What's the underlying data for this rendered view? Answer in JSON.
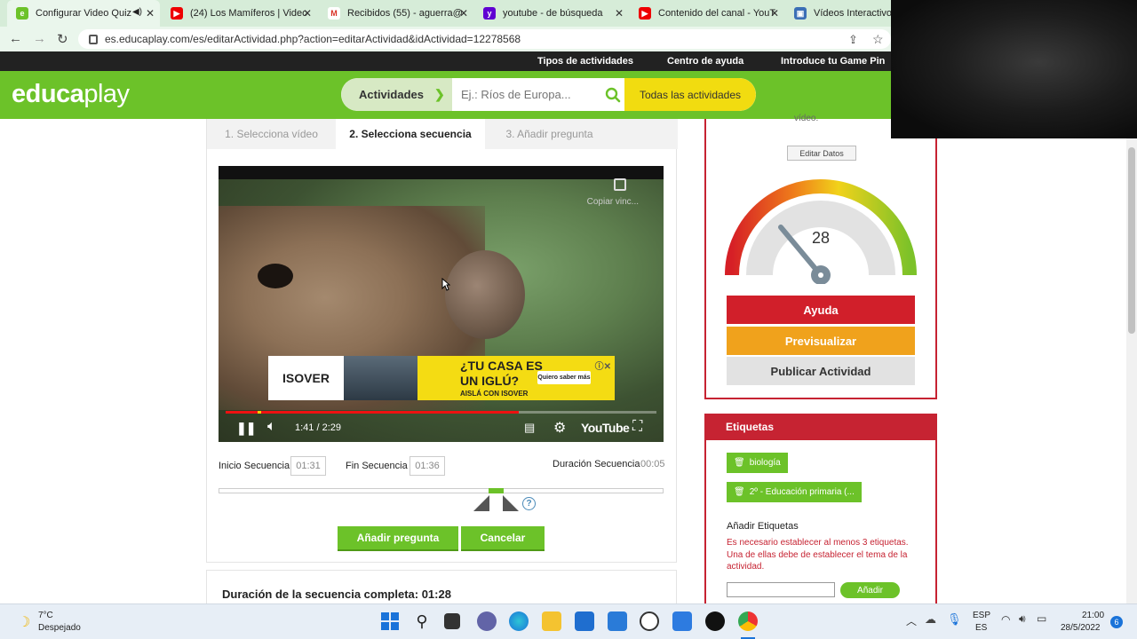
{
  "browser": {
    "tabs": [
      {
        "title": "Configurar Video Quiz",
        "active": true,
        "fav_color": "#6cc229",
        "fav": "e"
      },
      {
        "title": "(24) Los Mamíferos | Video",
        "active": false,
        "fav_color": "#e00",
        "fav": "▶"
      },
      {
        "title": "Recibidos (55) - aguerra@",
        "active": false,
        "fav_color": "#d93025",
        "fav": "M"
      },
      {
        "title": "youtube - de búsqueda",
        "active": false,
        "fav_color": "#6001d2",
        "fav": "y"
      },
      {
        "title": "Contenido del canal - YouT",
        "active": false,
        "fav_color": "#e00",
        "fav": "▶"
      },
      {
        "title": "Vídeos Interactivos: A",
        "active": false,
        "fav_color": "#3b6fb6",
        "fav": "▣"
      }
    ],
    "url": "es.educaplay.com/es/editarActividad.php?action=editarActividad&idActividad=12278568"
  },
  "topbar": {
    "links": [
      "Tipos de actividades",
      "Centro de ayuda",
      "Introduce tu Game Pin"
    ]
  },
  "header": {
    "logo_a": "educa",
    "logo_b": "play",
    "activities_label": "Actividades",
    "search_placeholder": "Ej.: Ríos de Europa...",
    "all_activities": "Todas las actividades"
  },
  "steps": [
    "1. Selecciona vídeo",
    "2. Selecciona secuencia",
    "3. Añadir pregunta"
  ],
  "video": {
    "copy_label": "Copiar vinc...",
    "time": "1:41 / 2:29",
    "played_fraction": 0.68,
    "brand": "YouTube",
    "ad": {
      "brand": "ISOVER",
      "line1": "¿TU CASA ES",
      "line2": "UN IGLÚ?",
      "line3": "AISLÁ CON ISOVER",
      "cta": "Quiero saber más"
    }
  },
  "sequence": {
    "start_label": "Inicio Secuencia",
    "start_value": "01:31",
    "end_label": "Fin Secuencia",
    "end_value": "01:36",
    "duration_label": "Duración Secuencia",
    "duration_value": "00:05",
    "help": "?",
    "add_question": "Añadir pregunta",
    "cancel": "Cancelar",
    "full_duration": "Duración de la secuencia completa:",
    "full_duration_value": "01:28"
  },
  "side": {
    "video_text": "vídeo.",
    "edit_data": "Editar Datos",
    "gauge_value": "28",
    "help": "Ayuda",
    "preview": "Previsualizar",
    "publish": "Publicar Actividad",
    "tags_title": "Etiquetas",
    "tags": [
      "biología",
      "2º - Educación primaria (..."
    ],
    "add_tags_label": "Añadir Etiquetas",
    "warning": "Es necesario establecer al menos 3 etiquetas. Una de ellas debe de establecer el tema de la actividad.",
    "add_button": "Añadir"
  },
  "taskbar": {
    "weather_temp": "7°C",
    "weather_desc": "Despejado",
    "lang1": "ESP",
    "lang2": "ES",
    "time": "21:00",
    "date": "28/5/2022",
    "notif": "6"
  },
  "colors": {
    "brand_green": "#6cc229",
    "brand_red": "#c62332",
    "yellow": "#f1dc10"
  }
}
